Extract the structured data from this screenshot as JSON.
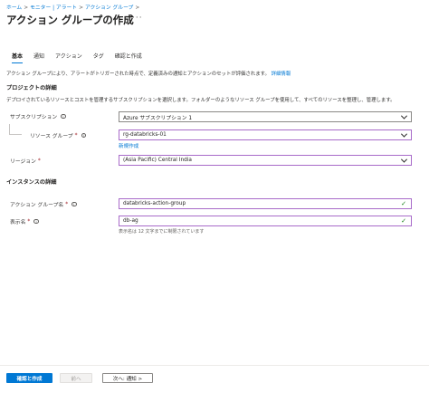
{
  "breadcrumb": [
    "ホーム",
    "モニター | アラート",
    "アクション グループ"
  ],
  "breadcrumb_sep": ">",
  "page_title": "アクション グループの作成",
  "more_label": "···",
  "tabs": [
    {
      "label": "基本",
      "active": true
    },
    {
      "label": "通知",
      "active": false
    },
    {
      "label": "アクション",
      "active": false
    },
    {
      "label": "タグ",
      "active": false
    },
    {
      "label": "確認と作成",
      "active": false
    }
  ],
  "description": "アクション グループにより、アラートがトリガーされた時点で、定義済みの通知とアクションのセットが評価されます。",
  "description_link": "詳細情報",
  "project_details": {
    "heading": "プロジェクトの詳細",
    "description": "デプロイされているリソースとコストを管理するサブスクリプションを選択します。フォルダーのようなリソース グループを使用して、すべてのリソースを整理し、管理します。",
    "subscription_label": "サブスクリプション",
    "subscription_value": "Azure サブスクリプション 1",
    "resource_group_label": "リソース グループ",
    "resource_group_value": "rg-databricks-01",
    "create_new_link": "新規作成",
    "region_label": "リージョン",
    "region_value": "(Asia Pacific) Central India"
  },
  "instance_details": {
    "heading": "インスタンスの詳細",
    "action_group_name_label": "アクション グループ名",
    "action_group_name_value": "databricks-action-group",
    "display_name_label": "表示名",
    "display_name_value": "db-ag",
    "display_name_hint": "表示名は 12 文字までに制限されています"
  },
  "info_glyph": "i",
  "required_mark": "*",
  "check_glyph": "✓",
  "footer": {
    "create_button": "確認と作成",
    "prev_button": "前へ",
    "next_button": "次へ: 通知 >"
  },
  "colors": {
    "accent": "#0078d4",
    "valid_border": "#a86bc9",
    "check": "#107c10"
  }
}
